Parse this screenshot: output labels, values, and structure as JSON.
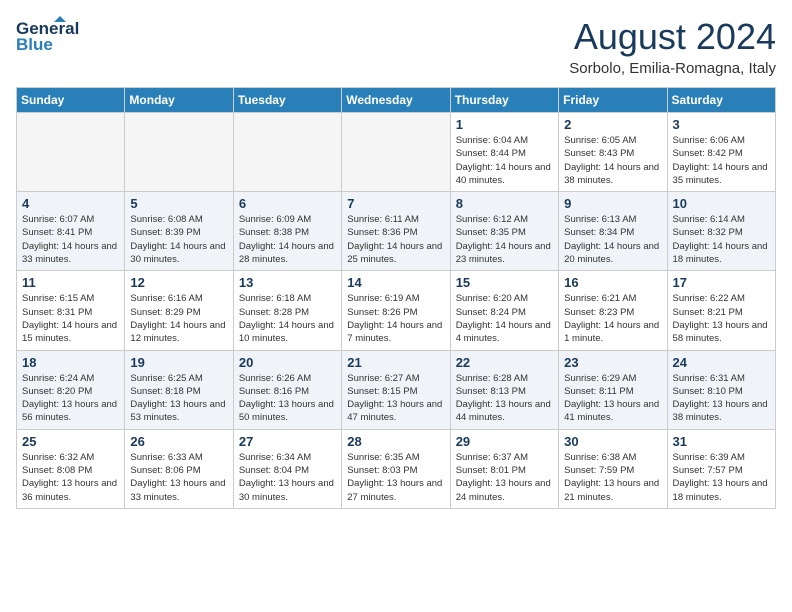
{
  "header": {
    "logo_line1": "General",
    "logo_line2": "Blue",
    "month_year": "August 2024",
    "location": "Sorbolo, Emilia-Romagna, Italy"
  },
  "weekdays": [
    "Sunday",
    "Monday",
    "Tuesday",
    "Wednesday",
    "Thursday",
    "Friday",
    "Saturday"
  ],
  "weeks": [
    [
      {
        "day": "",
        "empty": true
      },
      {
        "day": "",
        "empty": true
      },
      {
        "day": "",
        "empty": true
      },
      {
        "day": "",
        "empty": true
      },
      {
        "day": "1",
        "rise": "6:04 AM",
        "set": "8:44 PM",
        "daylight": "14 hours and 40 minutes."
      },
      {
        "day": "2",
        "rise": "6:05 AM",
        "set": "8:43 PM",
        "daylight": "14 hours and 38 minutes."
      },
      {
        "day": "3",
        "rise": "6:06 AM",
        "set": "8:42 PM",
        "daylight": "14 hours and 35 minutes."
      }
    ],
    [
      {
        "day": "4",
        "rise": "6:07 AM",
        "set": "8:41 PM",
        "daylight": "14 hours and 33 minutes."
      },
      {
        "day": "5",
        "rise": "6:08 AM",
        "set": "8:39 PM",
        "daylight": "14 hours and 30 minutes."
      },
      {
        "day": "6",
        "rise": "6:09 AM",
        "set": "8:38 PM",
        "daylight": "14 hours and 28 minutes."
      },
      {
        "day": "7",
        "rise": "6:11 AM",
        "set": "8:36 PM",
        "daylight": "14 hours and 25 minutes."
      },
      {
        "day": "8",
        "rise": "6:12 AM",
        "set": "8:35 PM",
        "daylight": "14 hours and 23 minutes."
      },
      {
        "day": "9",
        "rise": "6:13 AM",
        "set": "8:34 PM",
        "daylight": "14 hours and 20 minutes."
      },
      {
        "day": "10",
        "rise": "6:14 AM",
        "set": "8:32 PM",
        "daylight": "14 hours and 18 minutes."
      }
    ],
    [
      {
        "day": "11",
        "rise": "6:15 AM",
        "set": "8:31 PM",
        "daylight": "14 hours and 15 minutes."
      },
      {
        "day": "12",
        "rise": "6:16 AM",
        "set": "8:29 PM",
        "daylight": "14 hours and 12 minutes."
      },
      {
        "day": "13",
        "rise": "6:18 AM",
        "set": "8:28 PM",
        "daylight": "14 hours and 10 minutes."
      },
      {
        "day": "14",
        "rise": "6:19 AM",
        "set": "8:26 PM",
        "daylight": "14 hours and 7 minutes."
      },
      {
        "day": "15",
        "rise": "6:20 AM",
        "set": "8:24 PM",
        "daylight": "14 hours and 4 minutes."
      },
      {
        "day": "16",
        "rise": "6:21 AM",
        "set": "8:23 PM",
        "daylight": "14 hours and 1 minute."
      },
      {
        "day": "17",
        "rise": "6:22 AM",
        "set": "8:21 PM",
        "daylight": "13 hours and 58 minutes."
      }
    ],
    [
      {
        "day": "18",
        "rise": "6:24 AM",
        "set": "8:20 PM",
        "daylight": "13 hours and 56 minutes."
      },
      {
        "day": "19",
        "rise": "6:25 AM",
        "set": "8:18 PM",
        "daylight": "13 hours and 53 minutes."
      },
      {
        "day": "20",
        "rise": "6:26 AM",
        "set": "8:16 PM",
        "daylight": "13 hours and 50 minutes."
      },
      {
        "day": "21",
        "rise": "6:27 AM",
        "set": "8:15 PM",
        "daylight": "13 hours and 47 minutes."
      },
      {
        "day": "22",
        "rise": "6:28 AM",
        "set": "8:13 PM",
        "daylight": "13 hours and 44 minutes."
      },
      {
        "day": "23",
        "rise": "6:29 AM",
        "set": "8:11 PM",
        "daylight": "13 hours and 41 minutes."
      },
      {
        "day": "24",
        "rise": "6:31 AM",
        "set": "8:10 PM",
        "daylight": "13 hours and 38 minutes."
      }
    ],
    [
      {
        "day": "25",
        "rise": "6:32 AM",
        "set": "8:08 PM",
        "daylight": "13 hours and 36 minutes."
      },
      {
        "day": "26",
        "rise": "6:33 AM",
        "set": "8:06 PM",
        "daylight": "13 hours and 33 minutes."
      },
      {
        "day": "27",
        "rise": "6:34 AM",
        "set": "8:04 PM",
        "daylight": "13 hours and 30 minutes."
      },
      {
        "day": "28",
        "rise": "6:35 AM",
        "set": "8:03 PM",
        "daylight": "13 hours and 27 minutes."
      },
      {
        "day": "29",
        "rise": "6:37 AM",
        "set": "8:01 PM",
        "daylight": "13 hours and 24 minutes."
      },
      {
        "day": "30",
        "rise": "6:38 AM",
        "set": "7:59 PM",
        "daylight": "13 hours and 21 minutes."
      },
      {
        "day": "31",
        "rise": "6:39 AM",
        "set": "7:57 PM",
        "daylight": "13 hours and 18 minutes."
      }
    ]
  ],
  "labels": {
    "sunrise": "Sunrise:",
    "sunset": "Sunset:",
    "daylight": "Daylight:"
  }
}
